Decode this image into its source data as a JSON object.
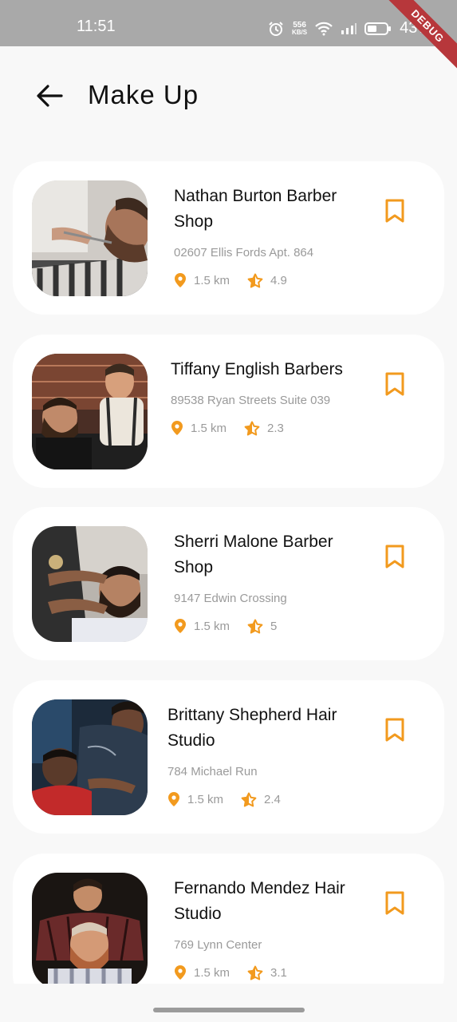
{
  "status_bar": {
    "time": "11:51",
    "net_speed_value": "556",
    "net_speed_unit": "KB/S",
    "battery": "43%",
    "debug_label": "DEBUG"
  },
  "header": {
    "title": "Make Up",
    "back_icon": "arrow-left-icon"
  },
  "colors": {
    "accent": "#f29a1e",
    "card_bg": "#ffffff",
    "page_bg": "#f8f8f8",
    "secondary_text": "#9a9a9a"
  },
  "shops": [
    {
      "name": "Nathan Burton Barber Shop",
      "address": "02607 Ellis Fords Apt. 864",
      "distance": "1.5 km",
      "rating": "4.9"
    },
    {
      "name": "Tiffany English Barbers",
      "address": "89538 Ryan Streets Suite 039",
      "distance": "1.5 km",
      "rating": "2.3"
    },
    {
      "name": "Sherri Malone Barber Shop",
      "address": "9147 Edwin Crossing",
      "distance": "1.5 km",
      "rating": "5"
    },
    {
      "name": "Brittany Shepherd Hair Studio",
      "address": "784 Michael Run",
      "distance": "1.5 km",
      "rating": "2.4"
    },
    {
      "name": "Fernando Mendez Hair Studio",
      "address": "769 Lynn Center",
      "distance": "1.5 km",
      "rating": "3.1"
    }
  ]
}
